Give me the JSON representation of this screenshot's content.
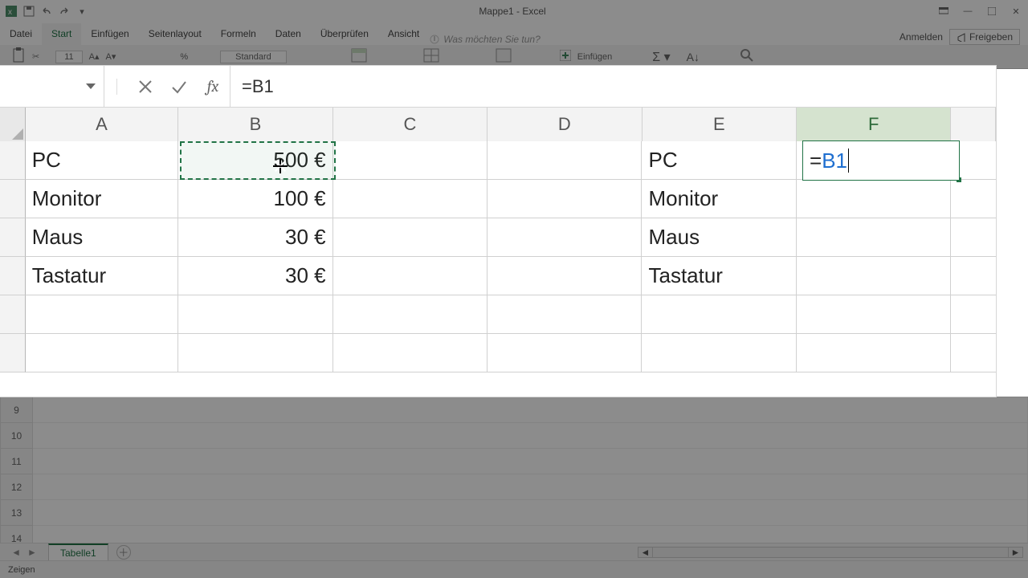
{
  "window": {
    "title": "Mappe1 - Excel"
  },
  "tabs": {
    "datei": "Datei",
    "start": "Start",
    "einfuegen": "Einfügen",
    "seitenlayout": "Seitenlayout",
    "formeln": "Formeln",
    "daten": "Daten",
    "ueberpruefen": "Überprüfen",
    "ansicht": "Ansicht",
    "tellme_placeholder": "Was möchten Sie tun?",
    "anmelden": "Anmelden",
    "freigeben": "Freigeben"
  },
  "ribbon": {
    "numfmt": "Standard",
    "insert_label": "Einfügen"
  },
  "formula_bar": {
    "name_box": "",
    "formula": "=B1"
  },
  "zoom_grid": {
    "columns": [
      "A",
      "B",
      "C",
      "D",
      "E",
      "F"
    ],
    "selected_column": "F",
    "rows": [
      {
        "A": "PC",
        "B": "500 €",
        "E": "PC"
      },
      {
        "A": "Monitor",
        "B": "100 €",
        "E": "Monitor"
      },
      {
        "A": "Maus",
        "B": "30 €",
        "E": "Maus"
      },
      {
        "A": "Tastatur",
        "B": "30 €",
        "E": "Tastatur"
      },
      {},
      {}
    ],
    "editing_cell": {
      "ref": "F1",
      "display_eq": "=",
      "display_ref": "B1"
    },
    "referenced_cell": "B1"
  },
  "bg_rownums": [
    "9",
    "10",
    "11",
    "12",
    "13",
    "14"
  ],
  "sheet": {
    "active": "Tabelle1"
  },
  "status": {
    "mode": "Zeigen"
  }
}
